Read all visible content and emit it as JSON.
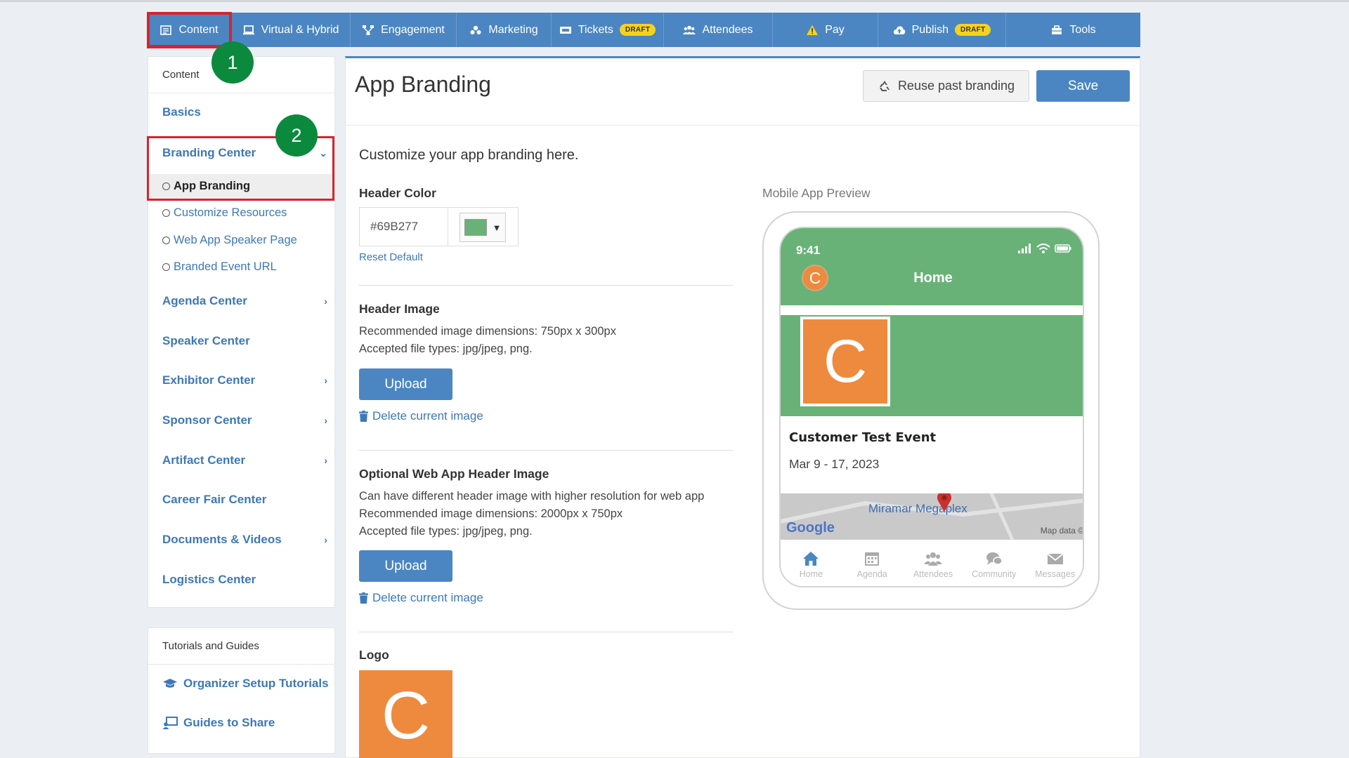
{
  "topnav": {
    "tabs": [
      {
        "label": "Content",
        "icon": "content-icon",
        "badge": ""
      },
      {
        "label": "Virtual & Hybrid",
        "icon": "laptop-icon",
        "badge": ""
      },
      {
        "label": "Engagement",
        "icon": "network-icon",
        "badge": ""
      },
      {
        "label": "Marketing",
        "icon": "marketing-icon",
        "badge": ""
      },
      {
        "label": "Tickets",
        "icon": "ticket-icon",
        "badge": "DRAFT"
      },
      {
        "label": "Attendees",
        "icon": "users-icon",
        "badge": ""
      },
      {
        "label": "Pay",
        "icon": "warning-icon",
        "badge": ""
      },
      {
        "label": "Publish",
        "icon": "cloud-upload-icon",
        "badge": "DRAFT"
      },
      {
        "label": "Tools",
        "icon": "toolbox-icon",
        "badge": ""
      }
    ]
  },
  "sidebar": {
    "header": "Content",
    "items": [
      {
        "label": "Basics",
        "chevron": ""
      },
      {
        "label": "Branding Center",
        "chevron": "⌄"
      },
      {
        "label": "Agenda Center",
        "chevron": "›"
      },
      {
        "label": "Speaker Center",
        "chevron": ""
      },
      {
        "label": "Exhibitor Center",
        "chevron": "›"
      },
      {
        "label": "Sponsor Center",
        "chevron": "›"
      },
      {
        "label": "Artifact Center",
        "chevron": "›"
      },
      {
        "label": "Career Fair Center",
        "chevron": ""
      },
      {
        "label": "Documents & Videos",
        "chevron": "›"
      },
      {
        "label": "Logistics Center",
        "chevron": ""
      }
    ],
    "subitems": [
      {
        "label": "App Branding"
      },
      {
        "label": "Customize Resources"
      },
      {
        "label": "Web App Speaker Page"
      },
      {
        "label": "Branded Event URL"
      }
    ]
  },
  "tutorials": {
    "header": "Tutorials and Guides",
    "items": [
      {
        "label": "Organizer Setup Tutorials",
        "icon": "graduation-cap-icon"
      },
      {
        "label": "Guides to Share",
        "icon": "share-guide-icon"
      }
    ]
  },
  "annotations": {
    "step1": "1",
    "step2": "2"
  },
  "main": {
    "title": "App Branding",
    "reuse_label": "Reuse past branding",
    "save_label": "Save",
    "intro": "Customize your app branding here.",
    "header_color": {
      "title": "Header Color",
      "value": "#69B277",
      "reset_label": "Reset Default",
      "caret": "▼"
    },
    "header_image": {
      "title": "Header Image",
      "desc_lines": [
        "Recommended image dimensions: 750px x 300px",
        "Accepted file types: jpg/jpeg, png."
      ],
      "upload_label": "Upload",
      "delete_label": "Delete current image"
    },
    "web_header_image": {
      "title": "Optional Web App Header Image",
      "desc_lines": [
        "Can have different header image with higher resolution for web app",
        "Recommended image dimensions: 2000px x 750px",
        "Accepted file types: jpg/jpeg, png."
      ],
      "upload_label": "Upload",
      "delete_label": "Delete current image"
    },
    "logo": {
      "title": "Logo",
      "letter": "C"
    }
  },
  "preview": {
    "label": "Mobile App Preview",
    "time": "9:41",
    "avatar_letter": "C",
    "home_title": "Home",
    "banner_letter": "C",
    "event_title": "Customer Test Event",
    "event_date": "Mar 9 - 17, 2023",
    "map_label": "Miramar Megaplex",
    "map_brand": "Google",
    "map_data": "Map data ©",
    "tabs": [
      {
        "label": "Home",
        "icon": "home-icon"
      },
      {
        "label": "Agenda",
        "icon": "calendar-icon"
      },
      {
        "label": "Attendees",
        "icon": "attendees-icon"
      },
      {
        "label": "Community",
        "icon": "chat-icon"
      },
      {
        "label": "Messages",
        "icon": "mail-icon"
      }
    ]
  },
  "colors": {
    "nav": "#4b86c2",
    "link": "#3d78b8",
    "header_color": "#69B277",
    "logo_orange": "#ee8a3d",
    "annotation_red": "#d9232d",
    "annotation_green": "#0b8a3d"
  }
}
